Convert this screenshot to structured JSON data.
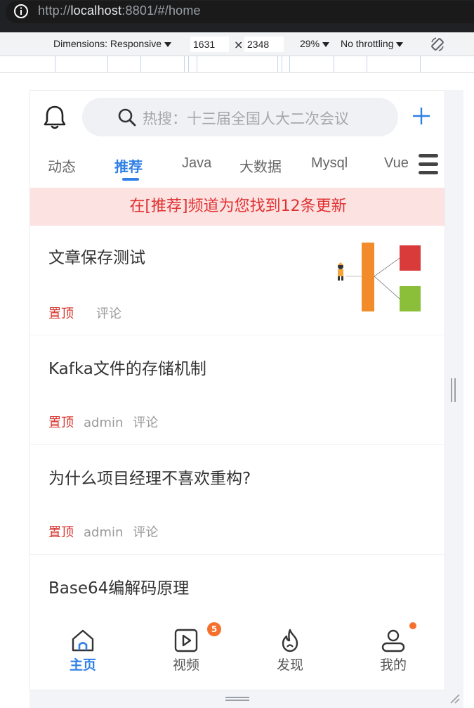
{
  "browser": {
    "url_prefix": "http://",
    "url_host": "localhost",
    "url_rest": ":8801/#/home"
  },
  "devtools": {
    "dimensions_label": "Dimensions: Responsive",
    "width": "1631",
    "times": "×",
    "height": "2348",
    "zoom": "29%",
    "throttling": "No throttling"
  },
  "header": {
    "search_placeholder": "热搜：十三届全国人大二次会议"
  },
  "tabs": [
    {
      "label": "动态",
      "active": false
    },
    {
      "label": "推荐",
      "active": true
    },
    {
      "label": "Java",
      "active": false
    },
    {
      "label": "大数据",
      "active": false
    },
    {
      "label": "Mysql",
      "active": false
    },
    {
      "label": "Vue",
      "active": false
    }
  ],
  "notice": "在[推荐]频道为您找到12条更新",
  "articles": [
    {
      "title": "文章保存测试",
      "pin": "置顶",
      "author": "",
      "comment": "评论",
      "has_thumb": true
    },
    {
      "title": "Kafka文件的存储机制",
      "pin": "置顶",
      "author": "admin",
      "comment": "评论",
      "has_thumb": false
    },
    {
      "title": "为什么项目经理不喜欢重构?",
      "pin": "置顶",
      "author": "admin",
      "comment": "评论",
      "has_thumb": false
    },
    {
      "title": "Base64编解码原理",
      "pin": "",
      "author": "",
      "comment": "",
      "has_thumb": false
    }
  ],
  "bottom_nav": [
    {
      "label": "主页",
      "icon": "home-icon",
      "active": true
    },
    {
      "label": "视频",
      "icon": "video-icon",
      "active": false,
      "badge": "5"
    },
    {
      "label": "发现",
      "icon": "fire-icon",
      "active": false
    },
    {
      "label": "我的",
      "icon": "user-icon",
      "active": false,
      "dot": true
    }
  ],
  "colors": {
    "accent": "#2f7fe6",
    "pin": "#d7342e",
    "notice_bg": "#fde2e2",
    "badge": "#f6702d"
  }
}
